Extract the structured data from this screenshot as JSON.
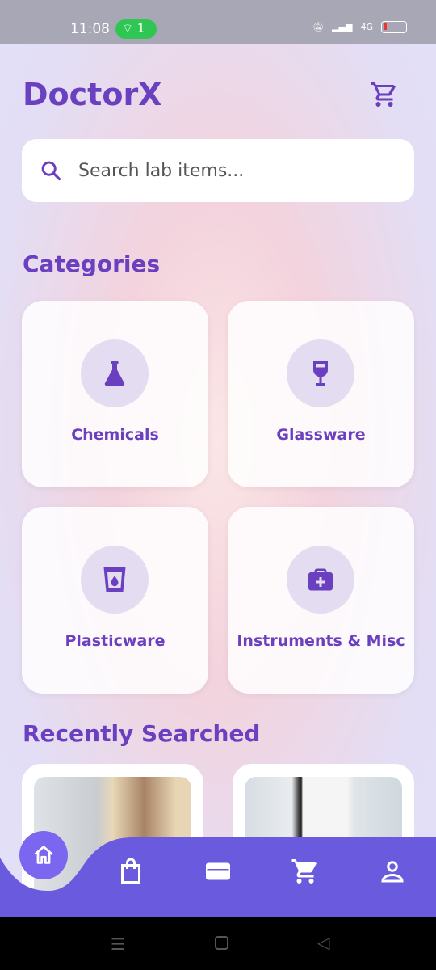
{
  "status_bar": {
    "time": "11:08",
    "hotspot_count": "1",
    "network": "4G"
  },
  "header": {
    "title": "DoctorX"
  },
  "search": {
    "placeholder": "Search lab items..."
  },
  "categories": {
    "title": "Categories",
    "items": [
      {
        "label": "Chemicals",
        "icon": "flask-icon"
      },
      {
        "label": "Glassware",
        "icon": "wine-glass-icon"
      },
      {
        "label": "Plasticware",
        "icon": "cup-icon"
      },
      {
        "label": "Instruments & Misc",
        "icon": "medical-kit-icon"
      }
    ]
  },
  "recent": {
    "title": "Recently Searched"
  },
  "bottom_nav": {
    "items": [
      "home",
      "shop",
      "wallet",
      "cart",
      "profile"
    ]
  },
  "colors": {
    "accent": "#6a3fc0",
    "nav": "#6a5ade",
    "home_button": "#7b66f0"
  }
}
